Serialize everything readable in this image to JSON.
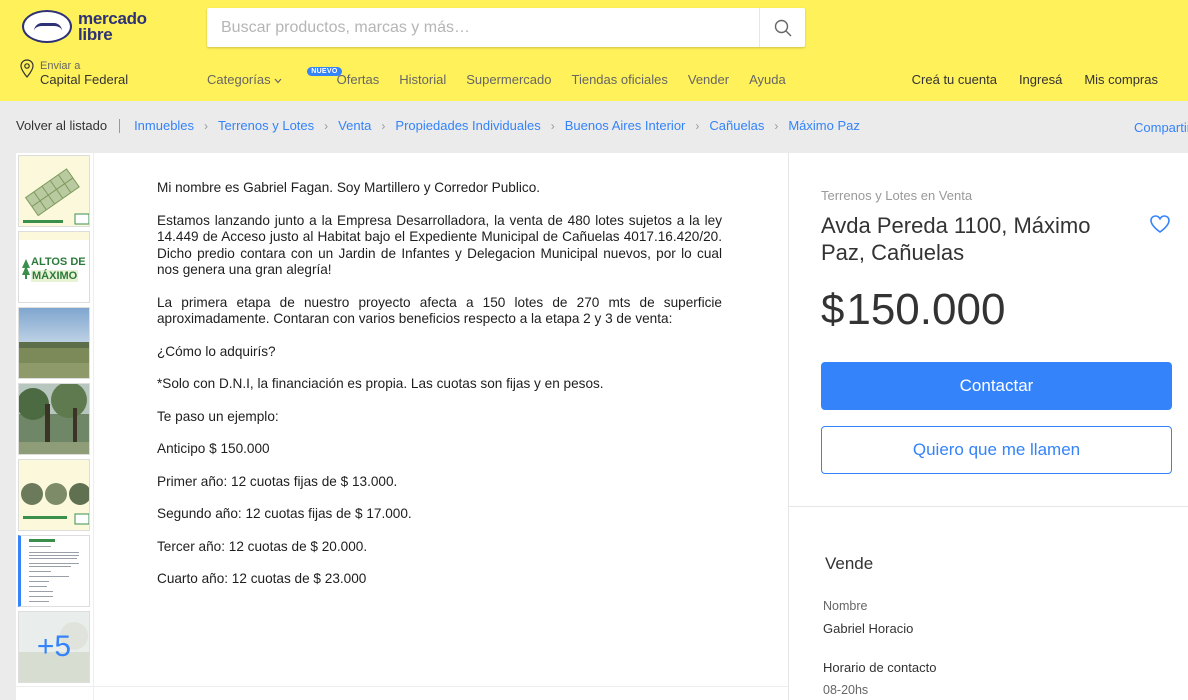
{
  "header": {
    "logo_line1": "mercado",
    "logo_line2": "libre",
    "search_placeholder": "Buscar productos, marcas y más…",
    "location_label": "Enviar a",
    "location_value": "Capital Federal",
    "nav": [
      "Categorías",
      "Ofertas",
      "Historial",
      "Supermercado",
      "Tiendas oficiales",
      "Vender",
      "Ayuda"
    ],
    "badge_new": "NUEVO",
    "user_nav": [
      "Creá tu cuenta",
      "Ingresá",
      "Mis compras"
    ]
  },
  "breadcrumb": {
    "back": "Volver al listado",
    "items": [
      "Inmuebles",
      "Terrenos y Lotes",
      "Venta",
      "Propiedades Individuales",
      "Buenos Aires Interior",
      "Cañuelas",
      "Máximo Paz"
    ],
    "share": "Compartir"
  },
  "thumbs": {
    "more_count": "+5",
    "logo_text_1": "ALTOS DE",
    "logo_text_2": "MÁXIMO"
  },
  "document": {
    "p1": "Mi nombre es Gabriel Fagan. Soy Martillero y Corredor Publico.",
    "p2": "Estamos lanzando junto a la Empresa Desarrolladora, la venta de 480 lotes sujetos a la ley 14.449 de Acceso justo al Habitat bajo el Expediente Municipal de Cañuelas 4017.16.420/20. Dicho predio contara con un Jardin de Infantes y Delegacion Municipal nuevos, por lo cual nos genera una gran alegría!",
    "p3": "La primera etapa de nuestro proyecto afecta a 150 lotes de 270 mts de superficie aproximadamente. Contaran con varios beneficios respecto a la etapa 2 y 3  de venta:",
    "p4": "¿Cómo lo adquirís?",
    "p5": "*Solo con D.N.I, la financiación es propia. Las cuotas son fijas y en pesos.",
    "p6": "Te paso un ejemplo:",
    "p7": "Anticipo $ 150.000",
    "p8": "Primer año: 12 cuotas fijas de $ 13.000.",
    "p9": "Segundo año: 12 cuotas fijas de $ 17.000.",
    "p10": "Tercer año: 12 cuotas de $ 20.000.",
    "p11": "Cuarto año: 12 cuotas de $ 23.000"
  },
  "listing": {
    "condition": "Terrenos y Lotes en Venta",
    "title": "Avda Pereda 1100, Máximo Paz, Cañuelas",
    "currency": "$",
    "price": "150.000",
    "contact_button": "Contactar",
    "call_button": "Quiero que me llamen"
  },
  "seller": {
    "section_title": "Vende",
    "name_label": "Nombre",
    "name_value": "Gabriel Horacio",
    "hours_label": "Horario de contacto",
    "hours_value": "08-20hs"
  },
  "colors": {
    "header_bg": "#fff159",
    "accent": "#3483fa",
    "brand_dark": "#2d3277"
  }
}
